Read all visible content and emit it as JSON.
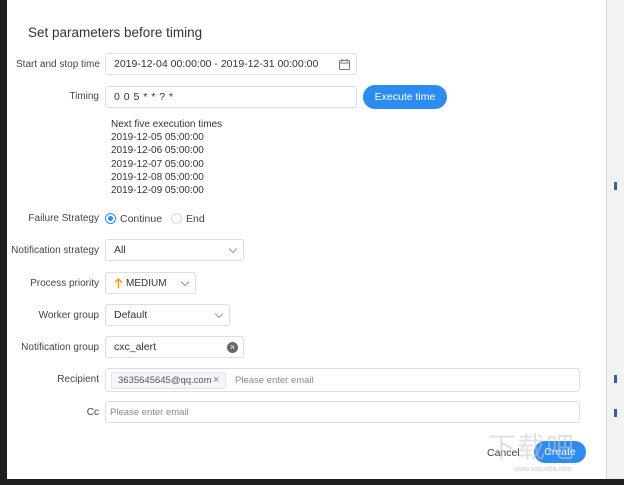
{
  "dialog": {
    "title": "Set parameters before timing"
  },
  "form": {
    "start_stop": {
      "label": "Start and stop time",
      "value": "2019-12-04 00:00:00 - 2019-12-31 00:00:00"
    },
    "timing": {
      "label": "Timing",
      "value": "0 0 5 * * ? *",
      "execute_button": "Execute time"
    },
    "next_times": {
      "title": "Next five execution times",
      "items": [
        "2019-12-05 05:00:00",
        "2019-12-06 05:00:00",
        "2019-12-07 05:00:00",
        "2019-12-08 05:00:00",
        "2019-12-09 05:00:00"
      ]
    },
    "failure_strategy": {
      "label": "Failure Strategy",
      "options": [
        "Continue",
        "End"
      ],
      "selected": "Continue"
    },
    "notification_strategy": {
      "label": "Notification strategy",
      "value": "All"
    },
    "process_priority": {
      "label": "Process priority",
      "value": "MEDIUM",
      "icon": "arrow-up-icon",
      "icon_color": "#ff9900"
    },
    "worker_group": {
      "label": "Worker group",
      "value": "Default"
    },
    "notification_group": {
      "label": "Notification group",
      "value": "cxc_alert"
    },
    "recipient": {
      "label": "Recipient",
      "tag": "3635645645@qq.com",
      "placeholder": "Please enter email"
    },
    "cc": {
      "label": "Cc",
      "placeholder": "Please enter email"
    }
  },
  "footer": {
    "cancel_label": "Cancel",
    "create_label": "Create"
  },
  "colors": {
    "primary": "#2d8cf0",
    "priority": "#ff9900"
  },
  "watermark": {
    "main": "下载吧",
    "sub": "www.xiazaiba.com"
  }
}
